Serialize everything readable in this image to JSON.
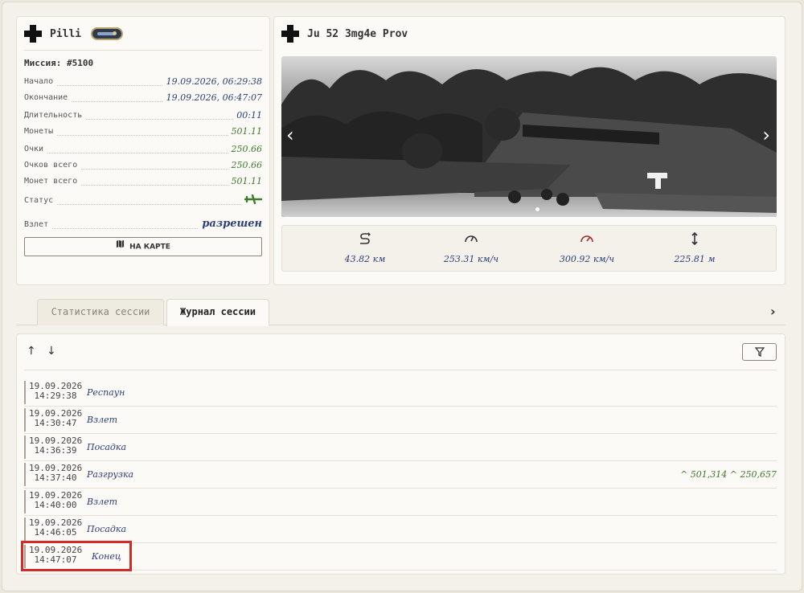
{
  "pilot": {
    "name": "Pilli"
  },
  "aircraft": {
    "name": "Ju 52 3mg4e Prov"
  },
  "mission": {
    "title": "Миссия: #5100",
    "rows": [
      {
        "label": "Начало",
        "value": "19.09.2026, 06:29:38"
      },
      {
        "label": "Окончание",
        "value": "19.09.2026, 06:47:07"
      },
      {
        "label": "Длительность",
        "value": "00:11"
      },
      {
        "label": "Монеты",
        "value": "501.11"
      },
      {
        "label": "Очки",
        "value": "250.66"
      },
      {
        "label": "Очков всего",
        "value": "250.66"
      },
      {
        "label": "Монет всего",
        "value": "501.11"
      },
      {
        "label": "Статус",
        "value": ""
      },
      {
        "label": "Взлет",
        "value": "разрешен"
      }
    ],
    "map_button": "НА КАРТЕ"
  },
  "stats": [
    {
      "icon": "distance-icon",
      "value": "43.82 км"
    },
    {
      "icon": "speedometer-icon",
      "value": "253.31 км/ч"
    },
    {
      "icon": "max-speed-icon",
      "value": "300.92 км/ч"
    },
    {
      "icon": "altitude-icon",
      "value": "225.81 м"
    }
  ],
  "tabs": [
    {
      "label": "Статистика сессии"
    },
    {
      "label": "Журнал сессии"
    }
  ],
  "log": [
    {
      "date": "19.09.2026",
      "time": "14:29:38",
      "event": "Респаун",
      "extra": ""
    },
    {
      "date": "19.09.2026",
      "time": "14:30:47",
      "event": "Взлет",
      "extra": ""
    },
    {
      "date": "19.09.2026",
      "time": "14:36:39",
      "event": "Посадка",
      "extra": ""
    },
    {
      "date": "19.09.2026",
      "time": "14:37:40",
      "event": "Разгрузка",
      "extra": "^ 501,314 ^ 250,657"
    },
    {
      "date": "19.09.2026",
      "time": "14:40:00",
      "event": "Взлет",
      "extra": ""
    },
    {
      "date": "19.09.2026",
      "time": "14:46:05",
      "event": "Посадка",
      "extra": ""
    },
    {
      "date": "19.09.2026",
      "time": "14:47:07",
      "event": "Конец",
      "extra": ""
    }
  ],
  "colors": {
    "accent_blue": "#2c3e78",
    "accent_green": "#3e7a2b",
    "highlight": "#d42a2a"
  }
}
